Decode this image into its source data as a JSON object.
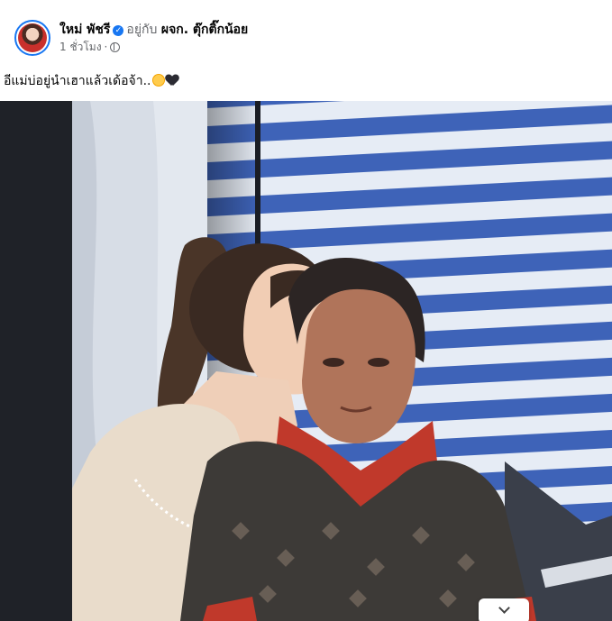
{
  "post": {
    "author": "ใหม่ พัชรี",
    "with_text": "อยู่กับ",
    "location": "ผจก. ตุ๊กติ๊กน้อย",
    "time": "1 ชั่วโมง",
    "separator": "·",
    "caption": "อีแม่บ่อยู่นำเฮาแล้วเด้อจ้า..",
    "caption_emojis": [
      "crying-face-icon",
      "black-heart-icon"
    ]
  },
  "icons": {
    "verified": "verified-badge-icon",
    "privacy": "globe-icon",
    "more": "chevron-down-icon"
  },
  "colors": {
    "brand": "#1877f2",
    "secondary_text": "#65676b",
    "tarp_blue": "#3e63b8",
    "tarp_white": "#e6ecf5"
  }
}
